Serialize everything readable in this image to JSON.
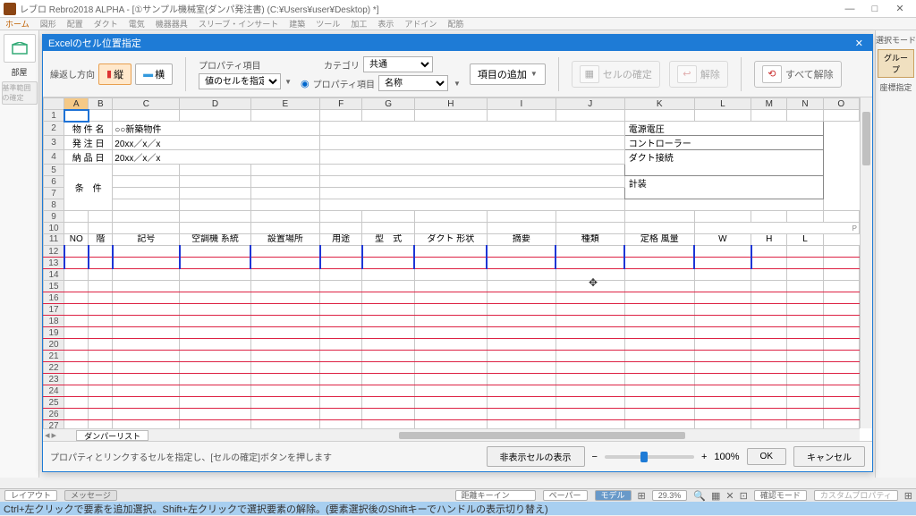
{
  "app": {
    "title": "レブロ Rebro2018 ALPHA - [①サンプル機械室(ダンパ発注書) (C:¥Users¥user¥Desktop) *]",
    "home": "ホーム"
  },
  "menu": [
    "図形",
    "配置",
    "ダクト",
    "電気",
    "機器器具",
    "スリーブ・インサート",
    "建築",
    "ツール",
    "加工",
    "表示",
    "アドイン",
    "配筋"
  ],
  "left": {
    "room": "部屋"
  },
  "right": {
    "mode": "選択モード",
    "group": "グループ",
    "coord": "座標指定"
  },
  "modal": {
    "title": "Excelのセル位置指定",
    "repeat_label": "繰返し方向",
    "vert": "縦",
    "horz": "横",
    "prop_section": "プロパティ項目",
    "cell_value": "値のセルを指定",
    "category": "カテゴリ",
    "category_val": "共通",
    "prop_item": "プロパティ項目",
    "prop_item_val": "名称",
    "add_item": "項目の追加",
    "cell_confirm": "セルの確定",
    "release": "解除",
    "release_all": "すべて解除",
    "base_confirm": "基準範囲の確定",
    "hint": "プロパティとリンクするセルを指定し、[セルの確定]ボタンを押します",
    "hide_cells": "非表示セルの表示",
    "zoom": "100%",
    "ok": "OK",
    "cancel": "キャンセル",
    "sheet_tab": "ダンパーリスト"
  },
  "cols": [
    "A",
    "B",
    "C",
    "D",
    "E",
    "F",
    "G",
    "H",
    "I",
    "J",
    "K",
    "L",
    "M",
    "N",
    "O"
  ],
  "info": {
    "r2": {
      "label": "物 件 名",
      "val": "○○新築物件"
    },
    "r3": {
      "label": "発 注 日",
      "val": "20xx／x／x"
    },
    "r4": {
      "label": "納 品 日",
      "val": "20xx／x／x"
    },
    "r5": {
      "label": "条　件"
    }
  },
  "rlabels": [
    "電源電圧",
    "コントローラー",
    "ダクト接続",
    "計装"
  ],
  "hdr": {
    "no": "NO",
    "floor": "階",
    "symbol": "記号",
    "ac": "空調機\n系統",
    "loc": "設置場所",
    "use": "用途",
    "model": "型　式",
    "duct": "ダクト\n形状",
    "summary": "摘要",
    "type": "種類",
    "rated": "定格\n風量",
    "w": "W",
    "h": "H",
    "l": "L"
  },
  "status": {
    "layout": "レイアウト",
    "msg": "メッセージ",
    "help": "Ctrl+左クリックで要素を追加選択。Shift+左クリックで選択要素の解除。(要素選択後のShiftキーでハンドルの表示切り替え)",
    "dist": "距離キーイン",
    "paper": "ペーパー",
    "model": "モデル",
    "zoom": "29.3%",
    "confirm": "確認モード",
    "custom": "カスタムプロパティ"
  }
}
